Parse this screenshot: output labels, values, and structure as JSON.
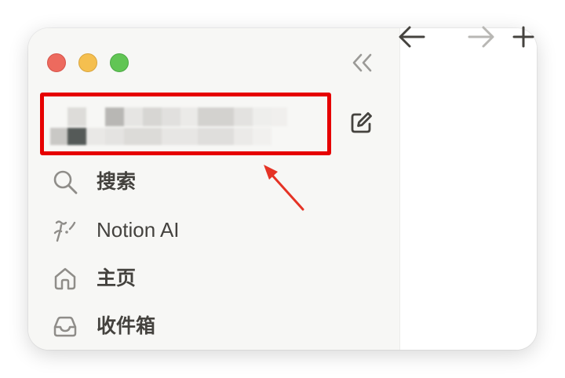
{
  "window": {
    "traffic_lights": {
      "close_color": "#ed6a5e",
      "minimize_color": "#f5bf4f",
      "maximize_color": "#61c554"
    }
  },
  "sidebar": {
    "collapse_icon": "double-chevron-left-icon",
    "compose_icon": "new-page-icon",
    "workspace": {
      "content": "",
      "highlight_color": "#e60000"
    },
    "items": [
      {
        "label": "搜索",
        "icon": "search-icon"
      },
      {
        "label": "Notion AI",
        "icon": "notion-ai-icon"
      },
      {
        "label": "主页",
        "icon": "home-icon"
      },
      {
        "label": "收件箱",
        "icon": "inbox-icon"
      }
    ]
  },
  "toolbar": {
    "back_icon": "arrow-left-icon",
    "forward_icon": "arrow-right-icon",
    "new_tab_icon": "plus-icon"
  },
  "annotation": {
    "arrow_color": "#e53325"
  }
}
